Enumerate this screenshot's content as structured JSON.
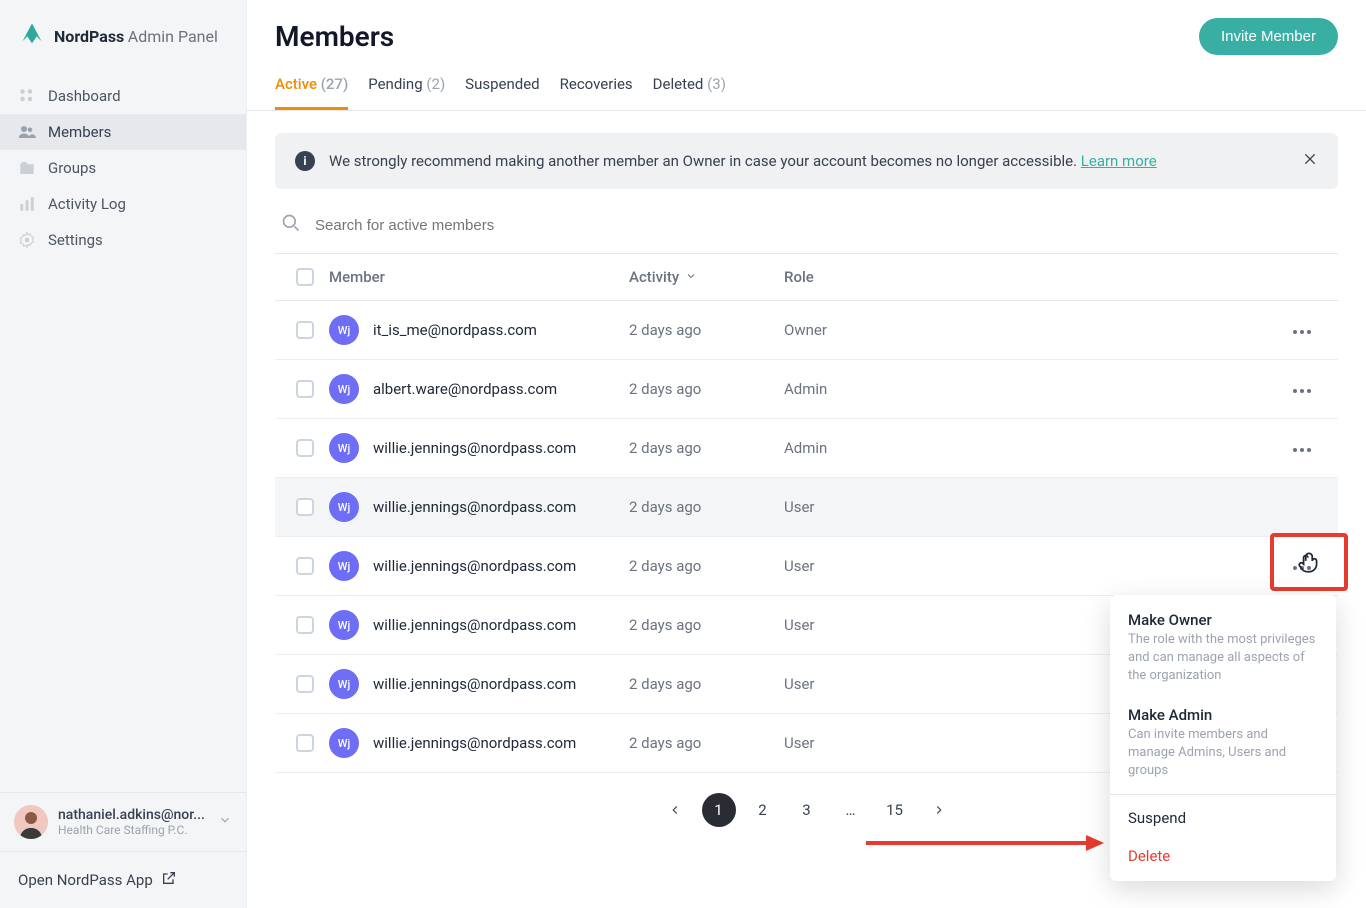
{
  "brand": {
    "name": "NordPass",
    "sub": "Admin Panel"
  },
  "sidebar": {
    "items": [
      {
        "label": "Dashboard"
      },
      {
        "label": "Members"
      },
      {
        "label": "Groups"
      },
      {
        "label": "Activity Log"
      },
      {
        "label": "Settings"
      }
    ]
  },
  "user": {
    "name": "nathaniel.adkins@nor...",
    "org": "Health Care Staffing P.C."
  },
  "open_app": "Open NordPass App",
  "header": {
    "title": "Members",
    "invite": "Invite Member"
  },
  "tabs": [
    {
      "label": "Active",
      "count": "(27)",
      "active": true
    },
    {
      "label": "Pending",
      "count": "(2)"
    },
    {
      "label": "Suspended",
      "count": ""
    },
    {
      "label": "Recoveries",
      "count": ""
    },
    {
      "label": "Deleted",
      "count": "(3)"
    }
  ],
  "banner": {
    "text": "We strongly recommend making another member an Owner in case your account becomes no longer accessible. ",
    "link": "Learn more"
  },
  "search": {
    "placeholder": "Search for active members"
  },
  "columns": {
    "member": "Member",
    "activity": "Activity",
    "role": "Role"
  },
  "rows": [
    {
      "initials": "Wj",
      "email": "it_is_me@nordpass.com",
      "activity": "2 days ago",
      "role": "Owner"
    },
    {
      "initials": "Wj",
      "email": "albert.ware@nordpass.com",
      "activity": "2 days ago",
      "role": "Admin"
    },
    {
      "initials": "Wj",
      "email": "willie.jennings@nordpass.com",
      "activity": "2 days ago",
      "role": "Admin"
    },
    {
      "initials": "Wj",
      "email": "willie.jennings@nordpass.com",
      "activity": "2 days ago",
      "role": "User",
      "hover": true
    },
    {
      "initials": "Wj",
      "email": "willie.jennings@nordpass.com",
      "activity": "2 days ago",
      "role": "User"
    },
    {
      "initials": "Wj",
      "email": "willie.jennings@nordpass.com",
      "activity": "2 days ago",
      "role": "User"
    },
    {
      "initials": "Wj",
      "email": "willie.jennings@nordpass.com",
      "activity": "2 days ago",
      "role": "User"
    },
    {
      "initials": "Wj",
      "email": "willie.jennings@nordpass.com",
      "activity": "2 days ago",
      "role": "User"
    }
  ],
  "dropdown": {
    "make_owner": {
      "title": "Make Owner",
      "desc": "The role with the most privileges and can manage all aspects of the organization"
    },
    "make_admin": {
      "title": "Make Admin",
      "desc": "Can invite members and manage Admins, Users and groups"
    },
    "suspend": {
      "title": "Suspend"
    },
    "delete": {
      "title": "Delete"
    }
  },
  "pagination": {
    "pages": [
      "1",
      "2",
      "3",
      "…",
      "15"
    ],
    "active": "1"
  }
}
